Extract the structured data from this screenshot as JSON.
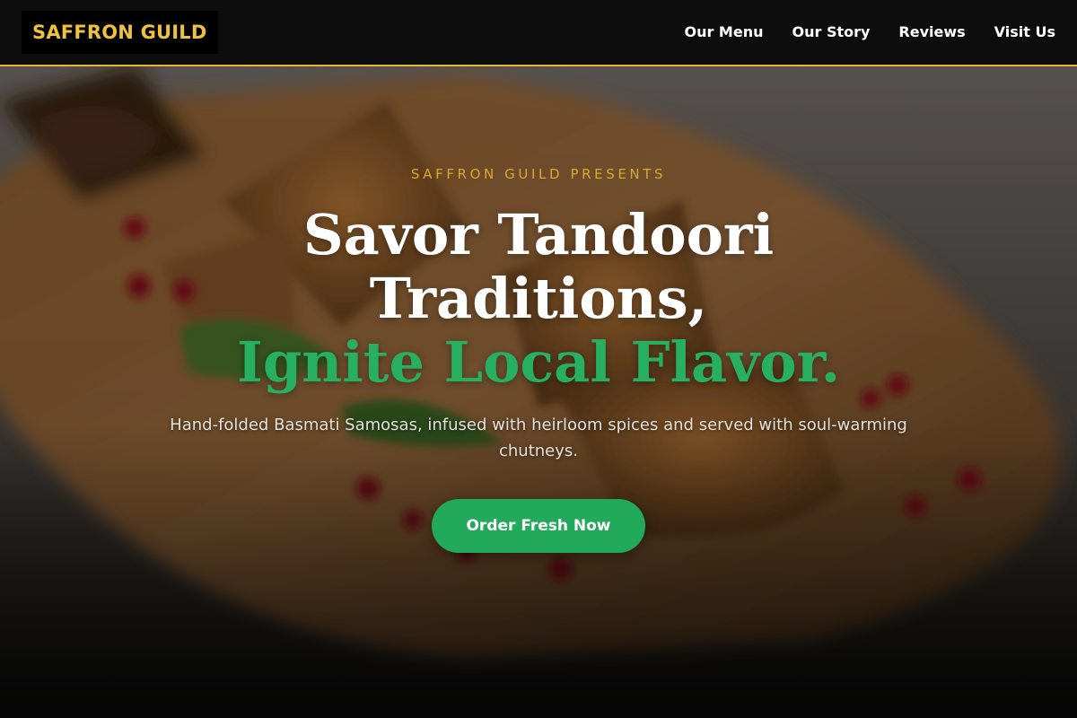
{
  "brand": {
    "name": "SAFFRON GUILD",
    "accent_color": "#f0c23b"
  },
  "nav": {
    "items": [
      {
        "label": "Our Menu"
      },
      {
        "label": "Our Story"
      },
      {
        "label": "Reviews"
      },
      {
        "label": "Visit Us"
      }
    ]
  },
  "hero": {
    "eyebrow": "SAFFRON GUILD PRESENTS",
    "headline_line1": "Savor Tandoori",
    "headline_line2": "Traditions,",
    "headline_accent": "Ignite Local Flavor.",
    "subtext": "Hand-folded Basmati Samosas, infused with heirloom spices and served with soul-warming chutneys.",
    "cta_label": "Order Fresh Now",
    "background_image": "samosa-platter-photo",
    "accent_green": "#27b062"
  }
}
